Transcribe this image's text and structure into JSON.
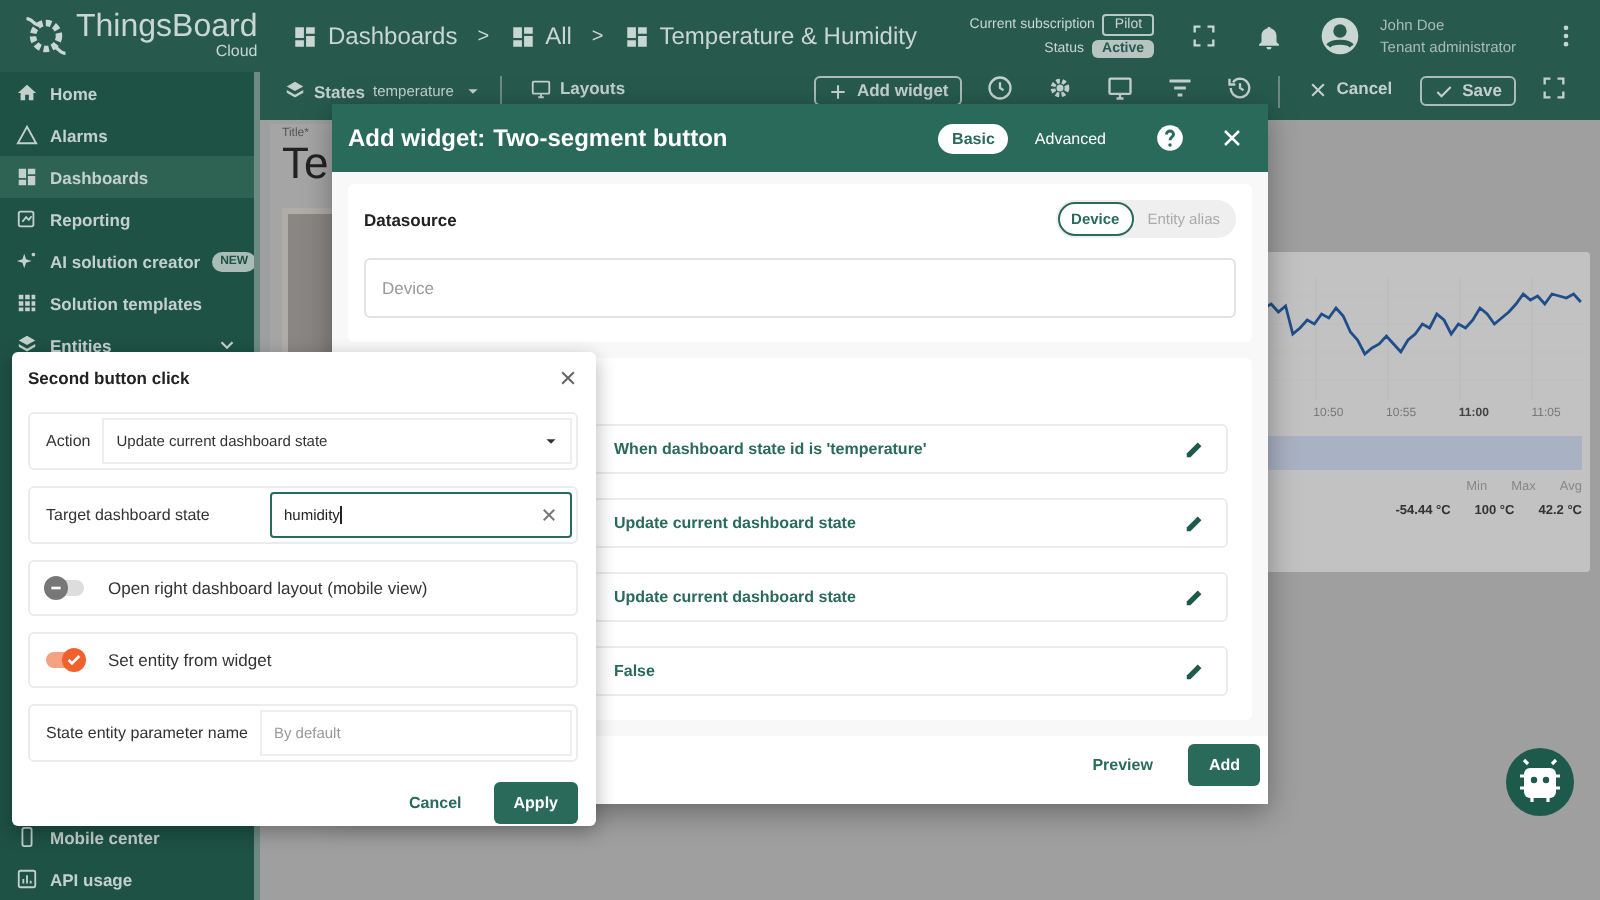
{
  "header": {
    "logo": {
      "name": "ThingsBoard",
      "sub": "Cloud"
    },
    "breadcrumbs": [
      {
        "label": "Dashboards"
      },
      {
        "separator": ">",
        "label": "All"
      },
      {
        "separator": ">",
        "label": "Temperature & Humidity"
      }
    ],
    "subscription": {
      "label": "Current subscription",
      "value": "Pilot"
    },
    "status": {
      "label": "Status",
      "value": "Active"
    },
    "user": {
      "name": "John Doe",
      "role": "Tenant administrator"
    }
  },
  "sidebar": {
    "items": [
      {
        "label": "Home",
        "selected": false
      },
      {
        "label": "Alarms",
        "selected": false
      },
      {
        "label": "Dashboards",
        "selected": true
      },
      {
        "label": "Reporting",
        "selected": false
      },
      {
        "label": "AI solution creator",
        "selected": false,
        "badge": "NEW"
      },
      {
        "label": "Solution templates",
        "selected": false
      },
      {
        "label": "Entities",
        "selected": false
      }
    ],
    "bottom_items": [
      {
        "label": "Mobile center",
        "selected": false
      },
      {
        "label": "API usage",
        "selected": false
      }
    ]
  },
  "toolbar": {
    "states": {
      "label": "States",
      "value": "temperature"
    },
    "layouts": "Layouts",
    "add_widget": "Add widget",
    "cancel": "Cancel",
    "save": "Save"
  },
  "dashboard": {
    "title_label": "Title*",
    "title": "Te",
    "chart": {
      "time_labels": [
        {
          "label": "10:50",
          "bold": false
        },
        {
          "label": "10:55",
          "bold": false
        },
        {
          "label": "11:00",
          "bold": true
        },
        {
          "label": "11:05",
          "bold": false
        }
      ],
      "stats": [
        {
          "label": "Min",
          "value": "-54.44 °C"
        },
        {
          "label": "Max",
          "value": "100 °C"
        },
        {
          "label": "Avg",
          "value": "42.2 °C"
        }
      ]
    }
  },
  "dialog": {
    "title_prefix": "Add widget:",
    "title": "Two-segment button",
    "modes": [
      {
        "label": "Basic",
        "selected": true
      },
      {
        "label": "Advanced",
        "selected": false
      }
    ],
    "datasource": {
      "heading": "Datasource",
      "types": [
        {
          "label": "Device",
          "selected": true
        },
        {
          "label": "Entity alias",
          "selected": false
        }
      ],
      "placeholder": "Device"
    },
    "actions": [
      "When dashboard state id is 'temperature'",
      "Update current dashboard state",
      "Update current dashboard state",
      "False"
    ],
    "preview": "Preview",
    "add": "Add"
  },
  "popover": {
    "title": "Second button click",
    "action": {
      "label": "Action",
      "value": "Update current dashboard state"
    },
    "target": {
      "label": "Target dashboard state",
      "value": "humidity"
    },
    "toggles": [
      {
        "label": "Open right dashboard layout (mobile view)",
        "on": false
      },
      {
        "label": "Set entity from widget",
        "on": true
      }
    ],
    "parameter": {
      "label": "State entity parameter name",
      "placeholder": "By default"
    },
    "cancel": "Cancel",
    "apply": "Apply"
  }
}
